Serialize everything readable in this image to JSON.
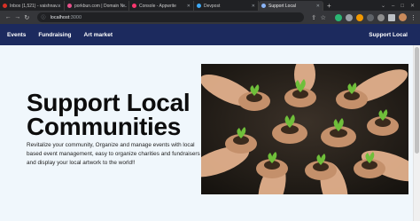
{
  "browser": {
    "tabs": [
      {
        "title": "Inbox (1,521) - vaishnav...",
        "color": "#d93025"
      },
      {
        "title": "porkbun.com | Domain N...",
        "color": "#e8508a"
      },
      {
        "title": "Console - Appwrite",
        "color": "#fd366e"
      },
      {
        "title": "Devpost",
        "color": "#3fa9f5"
      },
      {
        "title": "Support Local",
        "color": "#8ab4f8"
      }
    ],
    "new_tab": "+",
    "url_host": "localhost",
    "url_port": ":3000"
  },
  "nav": {
    "links": [
      "Events",
      "Fundraising",
      "Art market"
    ],
    "brand": "Support Local"
  },
  "hero": {
    "title_line1": "Support Local",
    "title_line2": "Communities",
    "description": "Revitalize your community, Organize and manage events with local based event management, easy to organize charities and fundraisers and display your local artwork to the world!!"
  },
  "icons": {
    "back": "arrow-left-icon",
    "forward": "arrow-right-icon",
    "reload": "reload-icon",
    "lock": "info-icon",
    "share": "share-icon",
    "star": "star-icon",
    "menu": "kebab-menu-icon"
  }
}
